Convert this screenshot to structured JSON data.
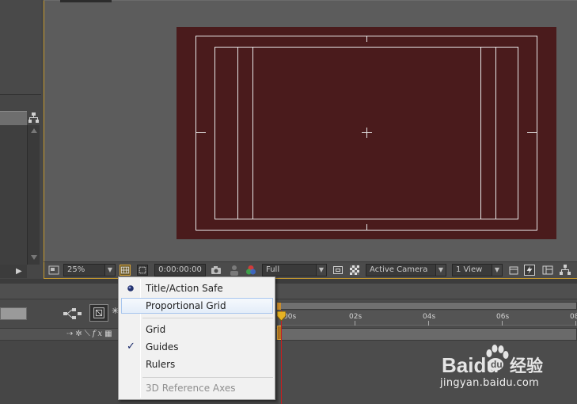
{
  "viewer_toolbar": {
    "zoom": "25%",
    "timecode": "0:00:00:00",
    "resolution": "Full",
    "camera": "Active Camera",
    "views": "1 View"
  },
  "timeline": {
    "ruler_labels": [
      "00s",
      "02s",
      "04s",
      "06s",
      "08"
    ]
  },
  "menu": {
    "items": [
      {
        "label": "Title/Action Safe",
        "marker": "radio",
        "state": "normal"
      },
      {
        "label": "Proportional Grid",
        "marker": "none",
        "state": "hover"
      },
      {
        "label": "Grid",
        "marker": "none",
        "state": "normal"
      },
      {
        "label": "Guides",
        "marker": "check",
        "state": "normal"
      },
      {
        "label": "Rulers",
        "marker": "none",
        "state": "normal"
      },
      {
        "label": "3D Reference Axes",
        "marker": "none",
        "state": "disabled"
      }
    ]
  },
  "watermark": {
    "brand": "Baidu",
    "brand_cn": "经验",
    "url": "jingyan.baidu.com"
  },
  "colors": {
    "comp_background": "#4a1b1c",
    "panel_highlight": "#c79a2e",
    "playhead": "#c81e1e",
    "menu_bg": "#f1f1f1"
  }
}
